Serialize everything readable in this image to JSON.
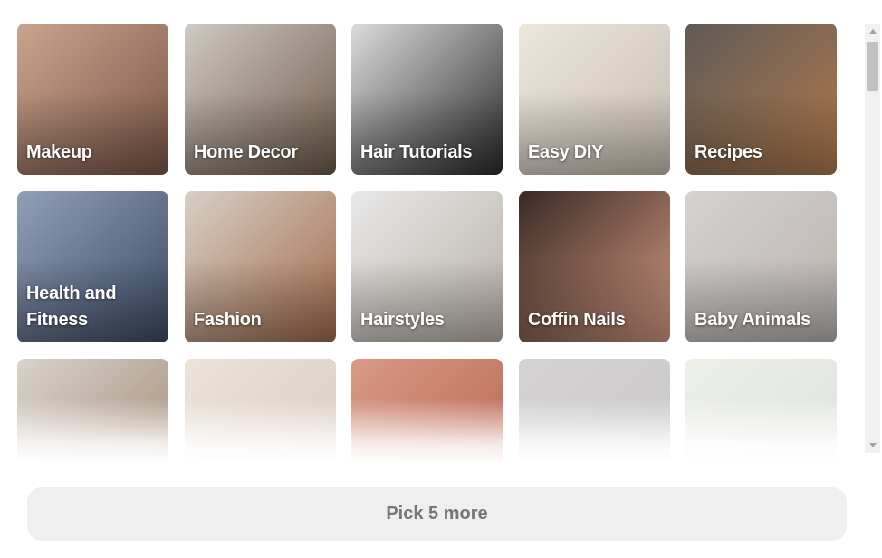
{
  "grid": {
    "rows": [
      [
        {
          "label": "Makeup",
          "colors": [
            "#c9a48e",
            "#7a5546"
          ]
        },
        {
          "label": "Home Decor",
          "colors": [
            "#cfcac4",
            "#6e5a48"
          ]
        },
        {
          "label": "Hair Tutorials",
          "colors": [
            "#dcdcdc",
            "#2a2a2a"
          ]
        },
        {
          "label": "Easy DIY",
          "colors": [
            "#ece6dd",
            "#c8beb1"
          ]
        },
        {
          "label": "Recipes",
          "colors": [
            "#5f5a55",
            "#b07a4e"
          ]
        }
      ],
      [
        {
          "label": "Health and Fitness",
          "colors": [
            "#8fa0b8",
            "#3c4a62"
          ]
        },
        {
          "label": "Fashion",
          "colors": [
            "#d8cfc6",
            "#a06a4a"
          ]
        },
        {
          "label": "Hairstyles",
          "colors": [
            "#e8e8e8",
            "#b8b0a6"
          ]
        },
        {
          "label": "Coffin Nails",
          "colors": [
            "#3a2a24",
            "#d39a82"
          ]
        },
        {
          "label": "Baby Animals",
          "colors": [
            "#d6d2cf",
            "#b8b2ae"
          ]
        }
      ],
      [
        {
          "label": "",
          "colors": [
            "#d9d3cc",
            "#9e8670"
          ]
        },
        {
          "label": "",
          "colors": [
            "#ebe3da",
            "#d6c9ba"
          ]
        },
        {
          "label": "",
          "colors": [
            "#d99a86",
            "#b5634f"
          ]
        },
        {
          "label": "",
          "colors": [
            "#d4d2d3",
            "#c8c6c8"
          ]
        },
        {
          "label": "",
          "colors": [
            "#eceee9",
            "#dfe3dc"
          ]
        }
      ]
    ]
  },
  "footer": {
    "button_label": "Pick 5 more"
  },
  "scrollbar": {
    "thumb_position_fraction": 0.0
  }
}
